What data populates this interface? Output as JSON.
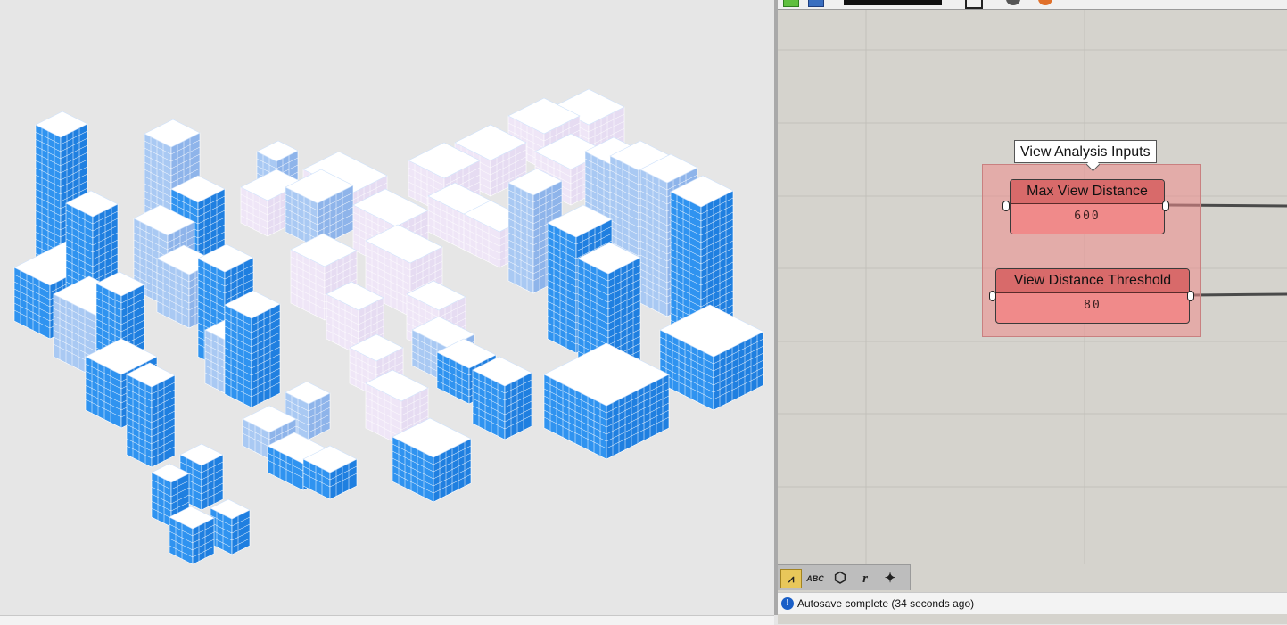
{
  "viewport": {
    "colors": {
      "background": "#e6e6e6",
      "facade_visible": "#2f93f0",
      "facade_partial": "#a9c9f3",
      "facade_faint": "#efe6f7",
      "roof": "#ffffff",
      "grid_line": "#ffffff"
    }
  },
  "grasshopper": {
    "canvas_color": "#d5d3cd",
    "group": {
      "label": "View Analysis Inputs",
      "color": "#ef8c8c"
    },
    "sliders": [
      {
        "name": "Max View Distance",
        "value": "600"
      },
      {
        "name": "View Distance Threshold",
        "value": "80"
      }
    ],
    "bottom_tools": [
      {
        "icon": "data-viewer-icon",
        "glyph": "⩘",
        "active": true
      },
      {
        "icon": "text-abc-icon",
        "glyph": "ABC",
        "active": false
      },
      {
        "icon": "component-hex-icon",
        "glyph": "⬡",
        "active": false
      },
      {
        "icon": "script-r-icon",
        "glyph": "r",
        "active": false
      },
      {
        "icon": "sparkle-icon",
        "glyph": "✦",
        "active": false
      }
    ],
    "status": {
      "text": "Autosave complete (34 seconds ago)"
    }
  }
}
